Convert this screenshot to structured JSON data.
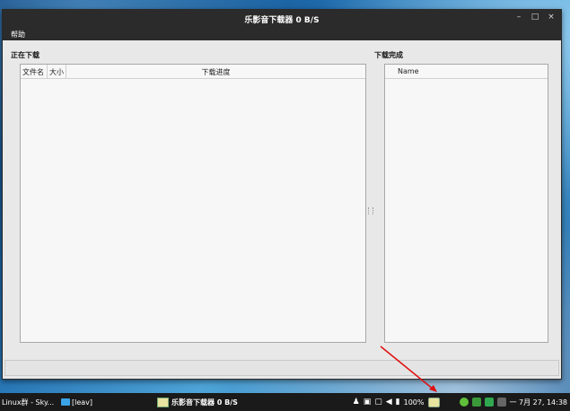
{
  "window": {
    "title": "乐影音下载器    0 B/S",
    "controls": {
      "minimize": "–",
      "maximize": "□",
      "close": "×"
    }
  },
  "menu": {
    "help": "帮助"
  },
  "downloading": {
    "label": "正在下载",
    "columns": [
      "文件名",
      "大小",
      "下载进度"
    ]
  },
  "finished": {
    "label": "下载完成",
    "columns": [
      "Name"
    ]
  },
  "taskbar": {
    "items": [
      {
        "label": "Linux群 - Sky..."
      },
      {
        "label": "[leav]"
      },
      {
        "label": "乐影音下载器    0 B/S"
      }
    ],
    "battery": "100%",
    "datetime": "一 7月 27, 14:38"
  },
  "colors": {
    "titlebar": "#2b2b2b",
    "window_bg": "#e8e8e8",
    "panel_bg": "#f7f7f7",
    "taskbar": "#1a1a1a",
    "annotation_arrow": "#e01010"
  }
}
